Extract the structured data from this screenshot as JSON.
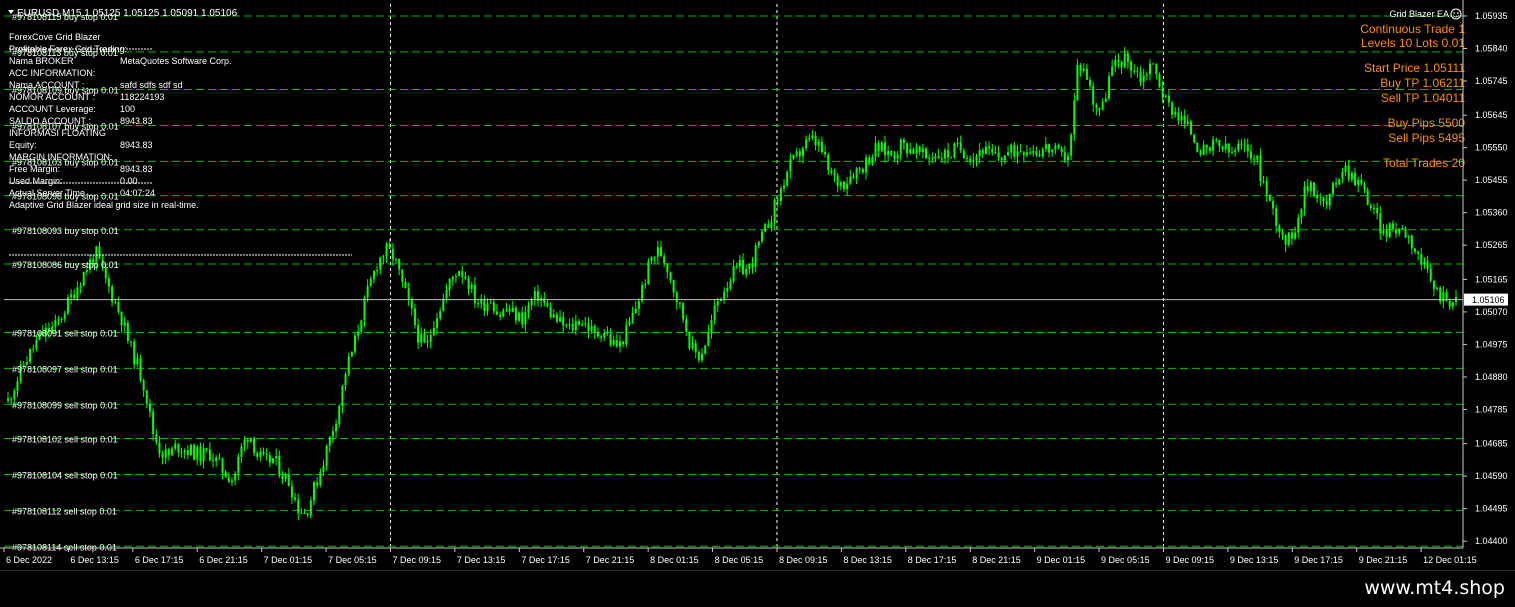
{
  "chart_header": "EURUSD,M15  1.05125 1.05125 1.05091 1.05106",
  "ea": {
    "name": "Grid Blazer EA",
    "smiley_icon": "smiley-face-icon",
    "orange_lines": [
      "Continuous Trade 1",
      "Levels 10   Lots 0.01",
      "Start Price 1.05111",
      "Buy TP 1.06211",
      "Sell TP 1.04011",
      "Buy Pips  5500",
      "Sell Pips  5495",
      "Total Trades  20"
    ]
  },
  "info_panel": [
    {
      "kind": "text",
      "text": "ForexCove Grid Blazer"
    },
    {
      "kind": "text",
      "text": "Profitable Forex Grid Trading:"
    },
    {
      "kind": "pair",
      "label": "Nama BROKER",
      "value": "MetaQuotes Software Corp."
    },
    {
      "kind": "text",
      "text": "ACC INFORMATION:"
    },
    {
      "kind": "pair",
      "label": "Nama ACCOUNT :",
      "value": "safd    sdfs sdf  sd"
    },
    {
      "kind": "pair",
      "label": "NOMOR ACCOUNT :",
      "value": "118224193"
    },
    {
      "kind": "pair",
      "label": "ACCOUNT  Leverage:",
      "value": "100"
    },
    {
      "kind": "pair",
      "label": " SALDO ACCOUNT :",
      "value": "8943.83"
    },
    {
      "kind": "text",
      "text": "INFORMASI FLOATING"
    },
    {
      "kind": "pair",
      "label": " Equity:",
      "value": "8943.83"
    },
    {
      "kind": "text",
      "text": "MARGIN INFORMATION:"
    },
    {
      "kind": "pair",
      "label": "Free Margin:",
      "value": "8943.83"
    },
    {
      "kind": "pair",
      "label": "Used Margin:",
      "value": "0.00"
    },
    {
      "kind": "pair",
      "label": "Actual Server Time",
      "value": "04:07:24"
    },
    {
      "kind": "text",
      "text": "Adaptive Grid Blazer ideal grid size in real-time."
    }
  ],
  "current_price_label": "1.05106",
  "footer": {
    "watermark": "www.mt4.shop"
  },
  "colors": {
    "background": "#000000",
    "candle": "#00ff00",
    "grid_line": "#00c000",
    "orange_text": "#ff8c00",
    "axis_text": "#ffffff",
    "price_line": "#c0c0c0"
  },
  "chart_data": {
    "type": "line",
    "symbol": "EURUSD",
    "timeframe": "M15",
    "header": {
      "open": 1.05125,
      "high": 1.05125,
      "low": 1.05091,
      "close": 1.05106
    },
    "ylim": [
      1.0438,
      1.0597
    ],
    "y_ticks": [
      "1.05935",
      "1.05840",
      "1.05745",
      "1.05645",
      "1.05550",
      "1.05455",
      "1.05360",
      "1.05265",
      "1.05165",
      "1.05070",
      "1.04975",
      "1.04880",
      "1.04785",
      "1.04685",
      "1.04590",
      "1.04495",
      "1.04400"
    ],
    "x_ticks": [
      "6 Dec 2022",
      "6 Dec 13:15",
      "6 Dec 17:15",
      "6 Dec 21:15",
      "7 Dec 01:15",
      "7 Dec 05:15",
      "7 Dec 09:15",
      "7 Dec 13:15",
      "7 Dec 17:15",
      "7 Dec 21:15",
      "8 Dec 01:15",
      "8 Dec 05:15",
      "8 Dec 09:15",
      "8 Dec 13:15",
      "8 Dec 17:15",
      "8 Dec 21:15",
      "9 Dec 01:15",
      "9 Dec 05:15",
      "9 Dec 09:15",
      "9 Dec 13:15",
      "9 Dec 17:15",
      "9 Dec 21:15",
      "12 Dec 01:15"
    ],
    "current_price": 1.05106,
    "grid_orders": [
      {
        "label": "#978108115 buy stop 0.01",
        "price": 1.05935
      },
      {
        "label": "#978108113 buy stop 0.01",
        "price": 1.0583
      },
      {
        "label": "#978108109 buy stop 0.01",
        "price": 1.0572
      },
      {
        "label": "#978108107 buy stop 0.01",
        "price": 1.05615
      },
      {
        "label": "#978108103 buy stop 0.01",
        "price": 1.0551
      },
      {
        "label": "#978108098 buy stop 0.01",
        "price": 1.0541
      },
      {
        "label": "#978108093 buy stop 0.01",
        "price": 1.0531
      },
      {
        "label": "#978108086 buy stop 0.01",
        "price": 1.0521
      },
      {
        "label": "#978108091 sell stop 0.01",
        "price": 1.0501
      },
      {
        "label": "#978108097 sell stop 0.01",
        "price": 1.04905
      },
      {
        "label": "#978108099 sell stop 0.01",
        "price": 1.048
      },
      {
        "label": "#978108102 sell stop 0.01",
        "price": 1.047
      },
      {
        "label": "#978108104 sell stop 0.01",
        "price": 1.04595
      },
      {
        "label": "#978108112 sell stop 0.01",
        "price": 1.0449
      },
      {
        "label": "#978108114 sell stop 0.01",
        "price": 1.04385
      }
    ],
    "close_path": [
      [
        0,
        1.0481
      ],
      [
        2,
        1.0492
      ],
      [
        4,
        1.05
      ],
      [
        6,
        1.0503
      ],
      [
        8,
        1.0512
      ],
      [
        10,
        1.0521
      ],
      [
        11,
        1.0524
      ],
      [
        12,
        1.0517
      ],
      [
        14,
        1.0506
      ],
      [
        15,
        1.0498
      ],
      [
        16,
        1.0492
      ],
      [
        17,
        1.0485
      ],
      [
        18,
        1.0472
      ],
      [
        19,
        1.0466
      ],
      [
        20,
        1.0465
      ],
      [
        21,
        1.0468
      ],
      [
        22,
        1.0467
      ],
      [
        23,
        1.0466
      ],
      [
        24,
        1.0465
      ],
      [
        25,
        1.0466
      ],
      [
        26,
        1.0463
      ],
      [
        27,
        1.046
      ],
      [
        28,
        1.0458
      ],
      [
        29,
        1.0467
      ],
      [
        30,
        1.0472
      ],
      [
        31,
        1.0465
      ],
      [
        32,
        1.0463
      ],
      [
        33,
        1.0464
      ],
      [
        34,
        1.046
      ],
      [
        35,
        1.0457
      ],
      [
        36,
        1.045
      ],
      [
        37,
        1.0448
      ],
      [
        38,
        1.0455
      ],
      [
        39,
        1.0462
      ],
      [
        40,
        1.047
      ],
      [
        41,
        1.0478
      ],
      [
        42,
        1.049
      ],
      [
        43,
        1.0497
      ],
      [
        44,
        1.0507
      ],
      [
        45,
        1.0515
      ],
      [
        46,
        1.0522
      ],
      [
        47,
        1.0525
      ],
      [
        48,
        1.0523
      ],
      [
        49,
        1.0515
      ],
      [
        50,
        1.0508
      ],
      [
        51,
        1.05
      ],
      [
        52,
        1.0496
      ],
      [
        53,
        1.0505
      ],
      [
        54,
        1.051
      ],
      [
        55,
        1.0516
      ],
      [
        56,
        1.052
      ],
      [
        57,
        1.0517
      ],
      [
        58,
        1.0511
      ],
      [
        59,
        1.0509
      ],
      [
        60,
        1.0511
      ],
      [
        61,
        1.0506
      ],
      [
        62,
        1.0508
      ],
      [
        63,
        1.0506
      ],
      [
        64,
        1.0505
      ],
      [
        65,
        1.051
      ],
      [
        66,
        1.0512
      ],
      [
        67,
        1.0508
      ],
      [
        68,
        1.0505
      ],
      [
        69,
        1.0503
      ],
      [
        70,
        1.0502
      ],
      [
        71,
        1.0505
      ],
      [
        72,
        1.0503
      ],
      [
        73,
        1.05
      ],
      [
        74,
        1.0502
      ],
      [
        75,
        1.0498
      ],
      [
        76,
        1.0497
      ],
      [
        77,
        1.0502
      ],
      [
        78,
        1.0508
      ],
      [
        79,
        1.0515
      ],
      [
        80,
        1.0523
      ],
      [
        81,
        1.0525
      ],
      [
        82,
        1.052
      ],
      [
        83,
        1.0512
      ],
      [
        84,
        1.0505
      ],
      [
        85,
        1.0496
      ],
      [
        86,
        1.0494
      ],
      [
        87,
        1.05
      ],
      [
        88,
        1.0509
      ],
      [
        89,
        1.0514
      ],
      [
        90,
        1.0518
      ],
      [
        91,
        1.052
      ],
      [
        92,
        1.0519
      ],
      [
        93,
        1.0525
      ],
      [
        94,
        1.053
      ],
      [
        95,
        1.0536
      ],
      [
        96,
        1.0542
      ],
      [
        97,
        1.0549
      ],
      [
        98,
        1.0552
      ],
      [
        99,
        1.0556
      ],
      [
        100,
        1.0557
      ],
      [
        101,
        1.0555
      ],
      [
        102,
        1.0548
      ],
      [
        103,
        1.0545
      ],
      [
        104,
        1.0545
      ],
      [
        105,
        1.0548
      ],
      [
        106,
        1.0549
      ],
      [
        107,
        1.0552
      ],
      [
        108,
        1.0555
      ],
      [
        109,
        1.0554
      ],
      [
        110,
        1.0553
      ],
      [
        111,
        1.0556
      ],
      [
        112,
        1.0555
      ],
      [
        113,
        1.0554
      ],
      [
        114,
        1.0552
      ],
      [
        115,
        1.0553
      ],
      [
        116,
        1.0553
      ],
      [
        117,
        1.0553
      ],
      [
        118,
        1.0555
      ],
      [
        119,
        1.0554
      ],
      [
        120,
        1.0552
      ],
      [
        121,
        1.0555
      ],
      [
        122,
        1.0553
      ],
      [
        123,
        1.0552
      ],
      [
        124,
        1.0553
      ],
      [
        125,
        1.0554
      ],
      [
        126,
        1.0555
      ],
      [
        127,
        1.0555
      ],
      [
        128,
        1.0554
      ],
      [
        129,
        1.0555
      ],
      [
        130,
        1.0554
      ],
      [
        131,
        1.0552
      ],
      [
        132,
        1.0554
      ],
      [
        133,
        1.058
      ],
      [
        134,
        1.0577
      ],
      [
        135,
        1.0568
      ],
      [
        136,
        1.0566
      ],
      [
        137,
        1.0577
      ],
      [
        138,
        1.058
      ],
      [
        139,
        1.0581
      ],
      [
        140,
        1.0578
      ],
      [
        141,
        1.0575
      ],
      [
        142,
        1.058
      ],
      [
        143,
        1.0575
      ],
      [
        144,
        1.0568
      ],
      [
        145,
        1.0566
      ],
      [
        146,
        1.0563
      ],
      [
        147,
        1.056
      ],
      [
        148,
        1.0555
      ],
      [
        149,
        1.0553
      ],
      [
        150,
        1.0556
      ],
      [
        151,
        1.0555
      ],
      [
        152,
        1.0553
      ],
      [
        153,
        1.0555
      ],
      [
        154,
        1.0554
      ],
      [
        155,
        1.0553
      ],
      [
        156,
        1.0545
      ],
      [
        157,
        1.0538
      ],
      [
        158,
        1.0532
      ],
      [
        159,
        1.0527
      ],
      [
        160,
        1.0532
      ],
      [
        161,
        1.0541
      ],
      [
        162,
        1.0545
      ],
      [
        163,
        1.054
      ],
      [
        164,
        1.0538
      ],
      [
        165,
        1.0545
      ],
      [
        166,
        1.055
      ],
      [
        167,
        1.0547
      ],
      [
        168,
        1.0545
      ],
      [
        169,
        1.054
      ],
      [
        170,
        1.0535
      ],
      [
        171,
        1.053
      ],
      [
        172,
        1.0531
      ],
      [
        173,
        1.0532
      ],
      [
        174,
        1.053
      ],
      [
        175,
        1.0525
      ],
      [
        176,
        1.052
      ],
      [
        177,
        1.0515
      ],
      [
        178,
        1.0512
      ],
      [
        179,
        1.0511
      ],
      [
        180,
        1.051
      ]
    ]
  }
}
